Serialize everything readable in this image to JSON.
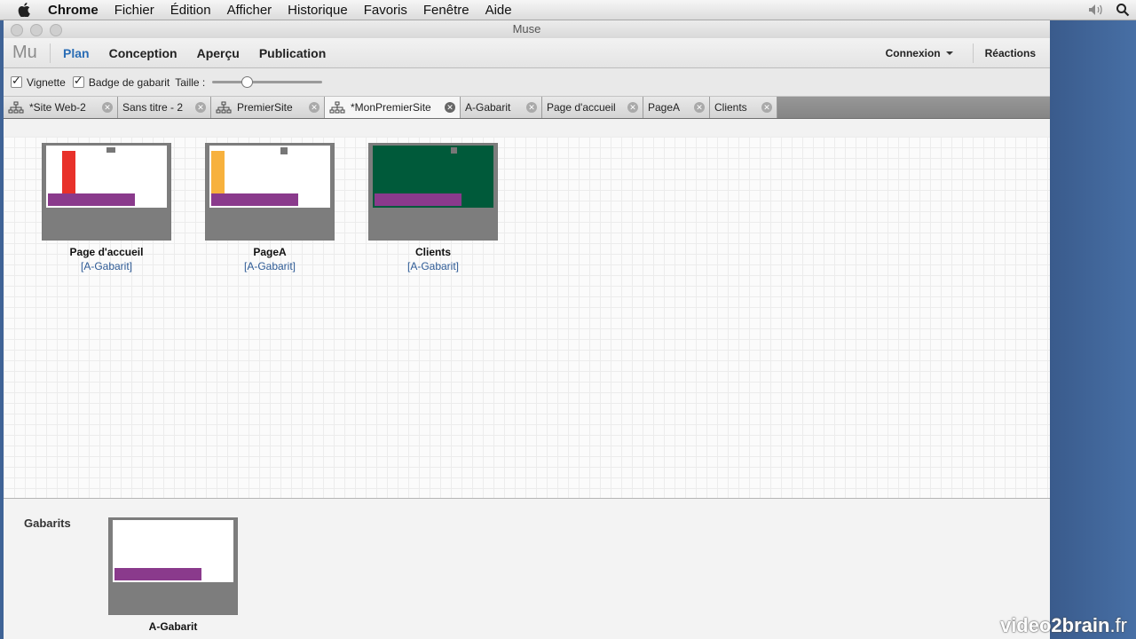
{
  "menubar": {
    "items": [
      "Chrome",
      "Fichier",
      "Édition",
      "Afficher",
      "Historique",
      "Favoris",
      "Fenêtre",
      "Aide"
    ]
  },
  "window": {
    "title": "Muse"
  },
  "appbar": {
    "logo": "Mu",
    "tabs": [
      "Plan",
      "Conception",
      "Aperçu",
      "Publication"
    ],
    "active_tab": "Plan",
    "connexion": "Connexion",
    "reactions": "Réactions"
  },
  "toolbar": {
    "vignette_label": "Vignette",
    "badge_label": "Badge de gabarit",
    "size_label": "Taille :",
    "vignette_checked": true,
    "badge_checked": true,
    "size_value": 0.3
  },
  "doc_tabs": [
    {
      "label": "*Site Web-2",
      "icon": "sitemap-icon"
    },
    {
      "label": "Sans titre - 2"
    },
    {
      "label": "PremierSite",
      "icon": "sitemap-icon"
    },
    {
      "label": "*MonPremierSite",
      "icon": "sitemap-icon",
      "active": true
    },
    {
      "label": "A-Gabarit"
    },
    {
      "label": "Page d'accueil"
    },
    {
      "label": "PageA"
    },
    {
      "label": "Clients"
    }
  ],
  "pages": [
    {
      "name": "Page d'accueil",
      "master": "[A-Gabarit]",
      "bg": "#ffffff",
      "accent": "#e8312a"
    },
    {
      "name": "PageA",
      "master": "[A-Gabarit]",
      "bg": "#ffffff",
      "accent": "#f7b13d"
    },
    {
      "name": "Clients",
      "master": "[A-Gabarit]",
      "bg": "#005a3a",
      "accent": ""
    }
  ],
  "masters": {
    "label": "Gabarits",
    "items": [
      {
        "name": "A-Gabarit"
      }
    ]
  },
  "colors": {
    "purple_bar": "#8a3a8c",
    "active_tab": "#2a6db5",
    "master_link": "#2d5a95"
  },
  "watermark": {
    "brand": "video2brain",
    "tld": ".fr"
  }
}
